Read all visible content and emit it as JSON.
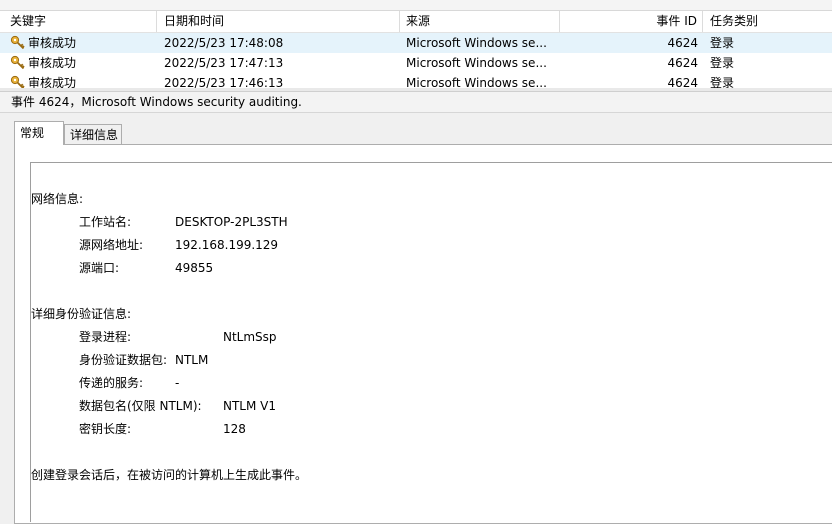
{
  "columns": {
    "keyword": "关键字",
    "datetime": "日期和时间",
    "source": "来源",
    "event_id": "事件 ID",
    "task_category": "任务类别"
  },
  "rows": [
    {
      "icon": "key-icon",
      "keyword": "审核成功",
      "datetime": "2022/5/23 17:48:08",
      "source": "Microsoft Windows se...",
      "event_id": "4624",
      "task": "登录"
    },
    {
      "icon": "key-icon",
      "keyword": "审核成功",
      "datetime": "2022/5/23 17:47:13",
      "source": "Microsoft Windows se...",
      "event_id": "4624",
      "task": "登录"
    },
    {
      "icon": "key-icon",
      "keyword": "审核成功",
      "datetime": "2022/5/23 17:46:13",
      "source": "Microsoft Windows se...",
      "event_id": "4624",
      "task": "登录"
    }
  ],
  "detail_title": "事件 4624，Microsoft Windows security auditing.",
  "tabs": {
    "general": "常规",
    "details": "详细信息"
  },
  "network": {
    "heading": "网络信息:",
    "workstation_label": "工作站名:",
    "workstation_value": "DESKTOP-2PL3STH",
    "source_address_label": "源网络地址:",
    "source_address_value": "192.168.199.129",
    "source_port_label": "源端口:",
    "source_port_value": "49855"
  },
  "auth": {
    "heading": "详细身份验证信息:",
    "logon_process_label": "登录进程:",
    "logon_process_value": "NtLmSsp",
    "auth_package_label": "身份验证数据包:",
    "auth_package_value": "NTLM",
    "transited_label": "传递的服务:",
    "transited_value": "-",
    "package_name_label": "数据包名(仅限 NTLM):",
    "package_name_value": "NTLM V1",
    "key_length_label": "密钥长度:",
    "key_length_value": "128"
  },
  "footer_text": "创建登录会话后，在被访问的计算机上生成此事件。",
  "colors": {
    "selected_row": "#e5f3fb",
    "border": "#adadad",
    "icon_key": "#d89a1a"
  }
}
